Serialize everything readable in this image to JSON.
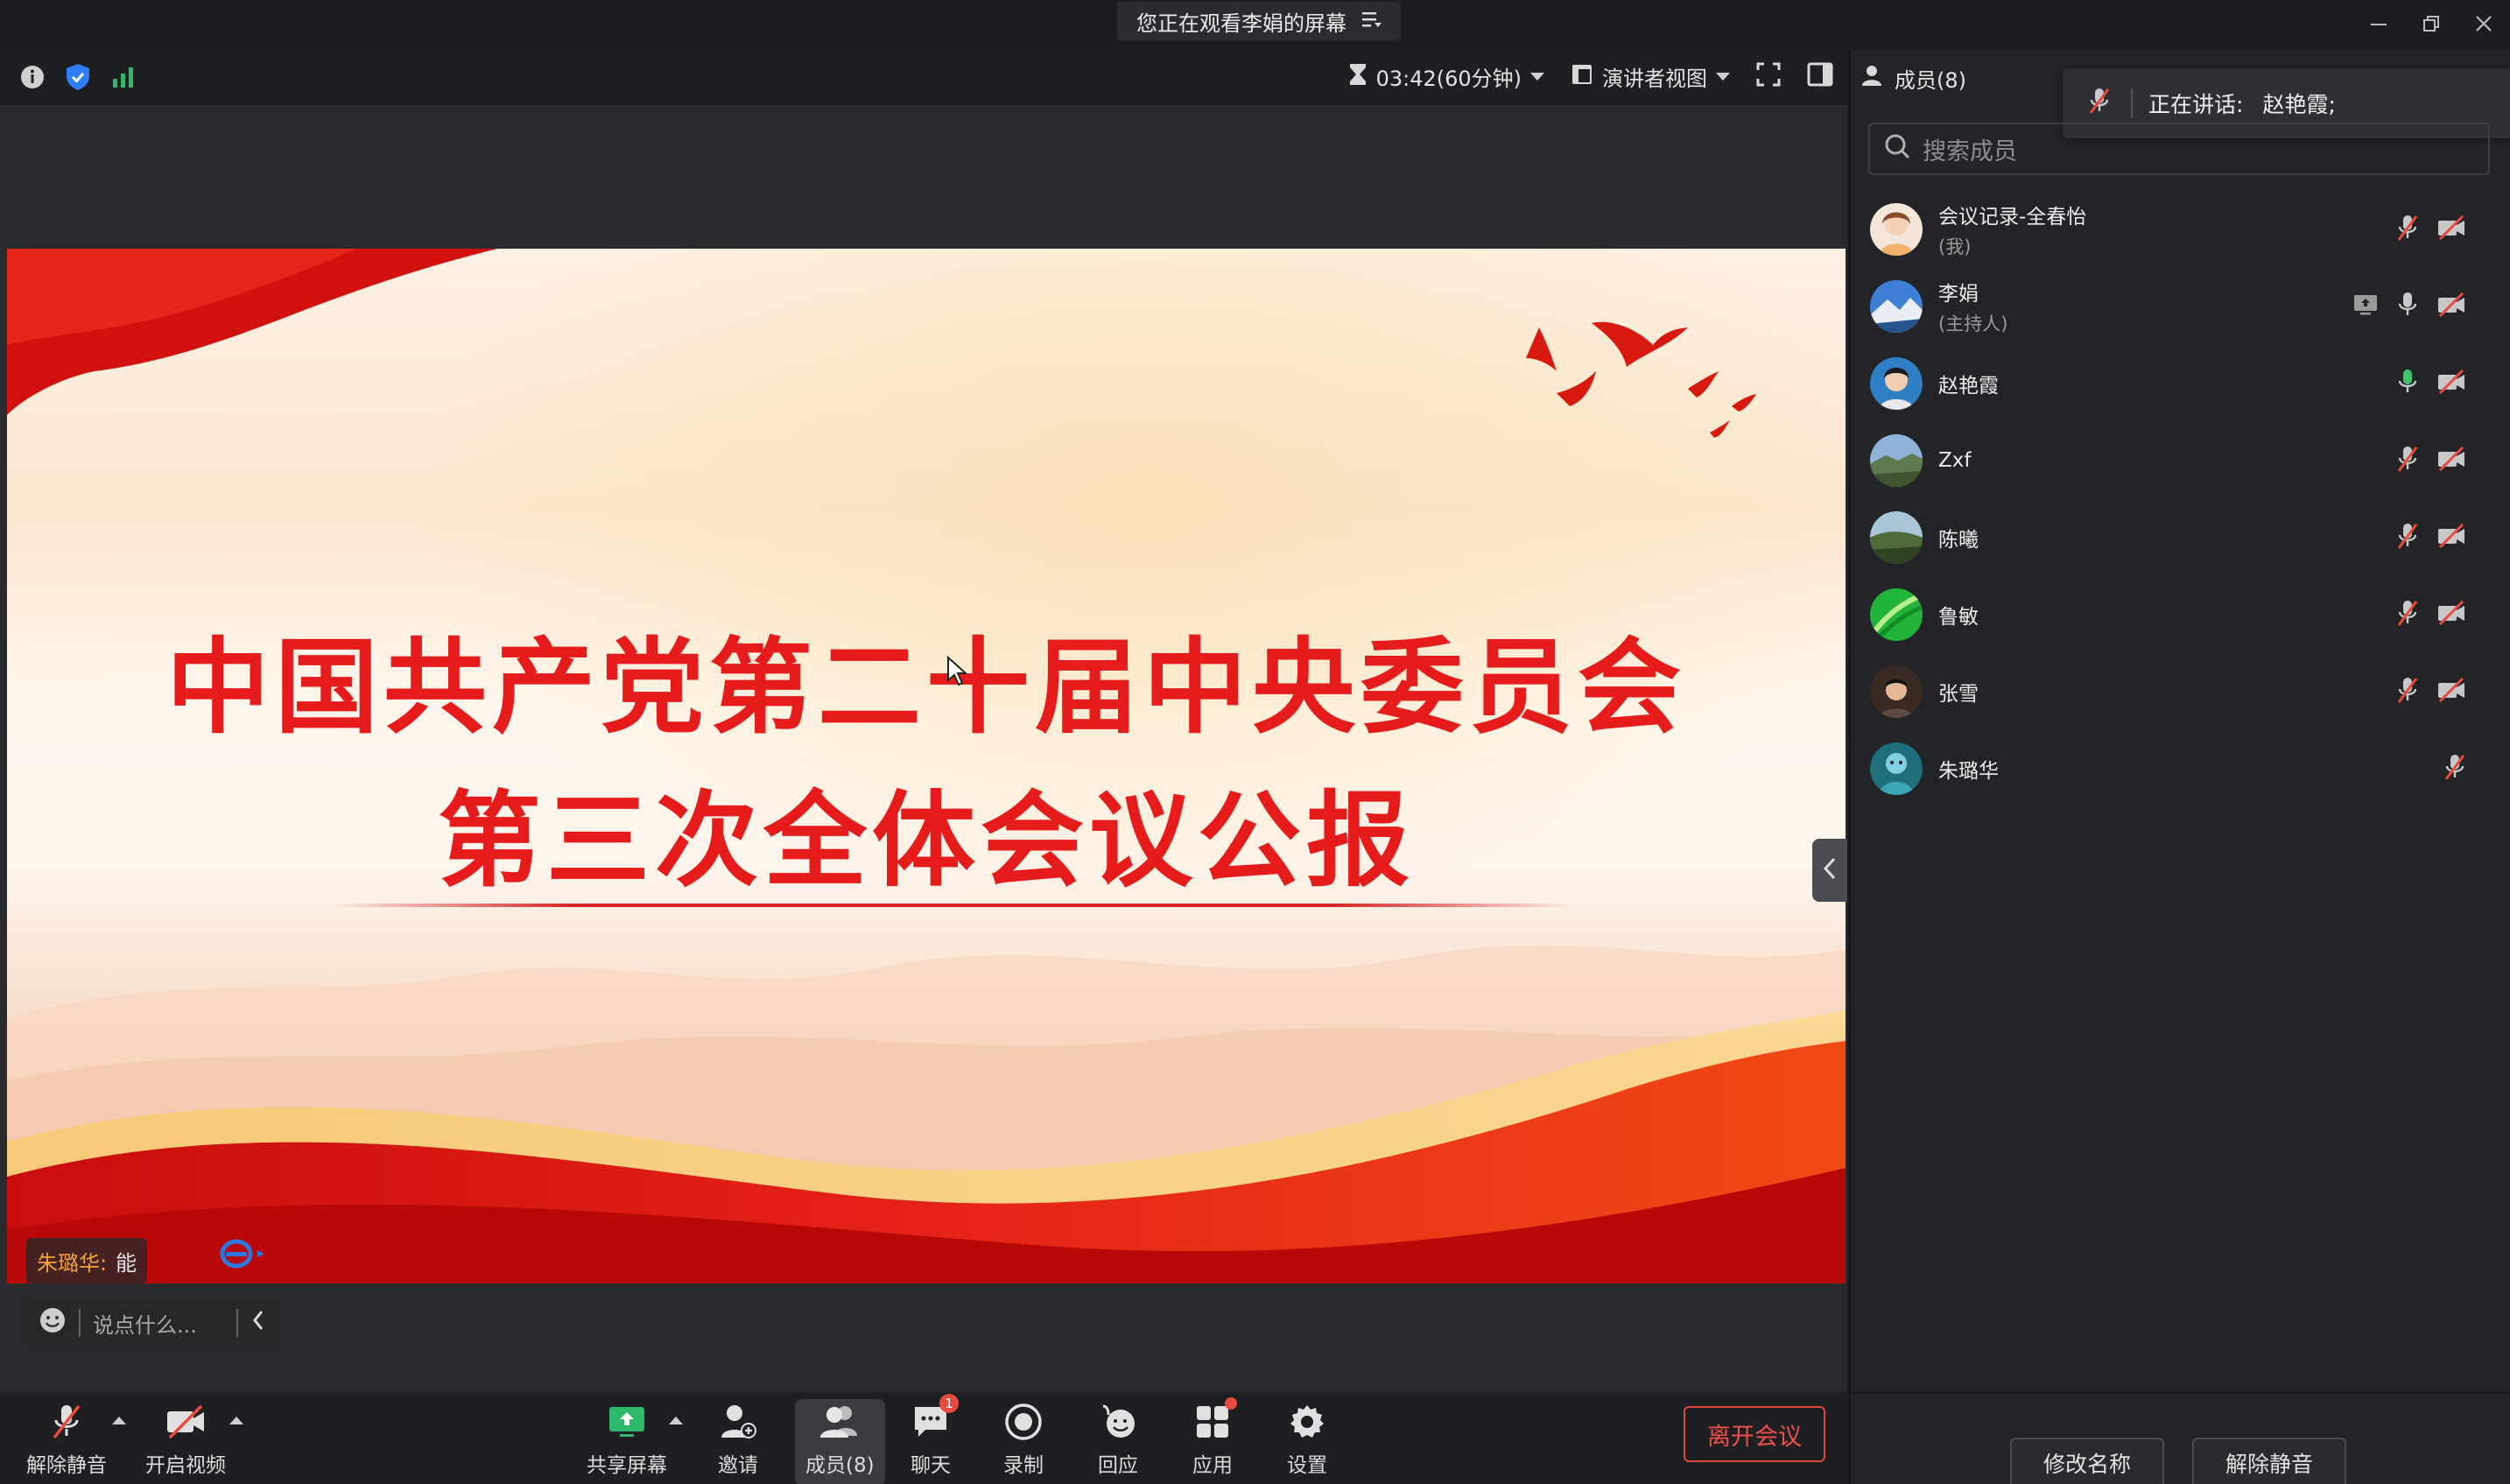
{
  "window": {
    "title": "您正在观看李娟的屏幕",
    "controls": [
      "minimize",
      "restore",
      "close"
    ]
  },
  "toolbar": {
    "timer": "03:42(60分钟)",
    "view_mode": "演讲者视图",
    "icons": [
      "info-icon",
      "shield-icon",
      "signal-icon",
      "hourglass-icon",
      "fullscreen-icon",
      "sidebar-toggle-icon"
    ]
  },
  "slide": {
    "line1": "中国共产党第二十届中央委员会",
    "line2": "第三次全体会议公报"
  },
  "chat": {
    "bubble_name": "朱璐华:",
    "bubble_text": "能",
    "input_placeholder": "说点什么..."
  },
  "bottom_bar": {
    "unmute": "解除静音",
    "start_video": "开启视频",
    "share_screen": "共享屏幕",
    "invite": "邀请",
    "members": "成员(8)",
    "chat": "聊天",
    "chat_badge": "1",
    "record": "录制",
    "react": "回应",
    "apps": "应用",
    "settings": "设置",
    "leave": "离开会议"
  },
  "panel": {
    "tab_members": "成员(8)",
    "speaking_label": "正在讲话:",
    "speaking_name": "赵艳霞;",
    "search_placeholder": "搜索成员",
    "members": [
      {
        "name": "会议记录-全春怡",
        "role": "(我)",
        "mic": "muted",
        "video": "off"
      },
      {
        "name": "李娟",
        "role": "(主持人)",
        "mic": "on",
        "video": "off",
        "sharing": true
      },
      {
        "name": "赵艳霞",
        "role": "",
        "mic": "speaking",
        "video": "off"
      },
      {
        "name": "Zxf",
        "role": "",
        "mic": "muted",
        "video": "off"
      },
      {
        "name": "陈曦",
        "role": "",
        "mic": "muted",
        "video": "off"
      },
      {
        "name": "鲁敏",
        "role": "",
        "mic": "muted",
        "video": "off"
      },
      {
        "name": "张雪",
        "role": "",
        "mic": "muted",
        "video": "off"
      },
      {
        "name": "朱璐华",
        "role": "",
        "mic": "muted",
        "video": "none"
      }
    ],
    "rename": "修改名称",
    "unmute_all": "解除静音"
  },
  "colors": {
    "accent_red": "#e84a3f",
    "speaking_green": "#3ec46d",
    "shield_blue": "#2f7ef7",
    "signal_green": "#2fb96b"
  }
}
